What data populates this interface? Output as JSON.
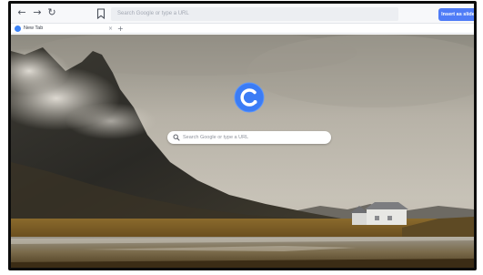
{
  "toolbar": {
    "back_icon": "arrow-left-icon",
    "forward_icon": "arrow-right-icon",
    "reload_icon": "reload-icon",
    "bookmark_icon": "bookmark-icon",
    "address_placeholder": "Search Google or type a URL",
    "insert_button_label": "Insert as slide"
  },
  "tabs": [
    {
      "title": "New Tab",
      "close_icon": "close-icon"
    }
  ],
  "new_tab_icon": "plus-icon",
  "ntp": {
    "logo_icon": "browser-logo-icon",
    "search_placeholder": "Search Google or type a URL",
    "search_icon": "search-icon"
  },
  "colors": {
    "accent": "#4f7cf7",
    "logo_blue": "#3b7cf5",
    "frame": "#0c0c0c"
  }
}
